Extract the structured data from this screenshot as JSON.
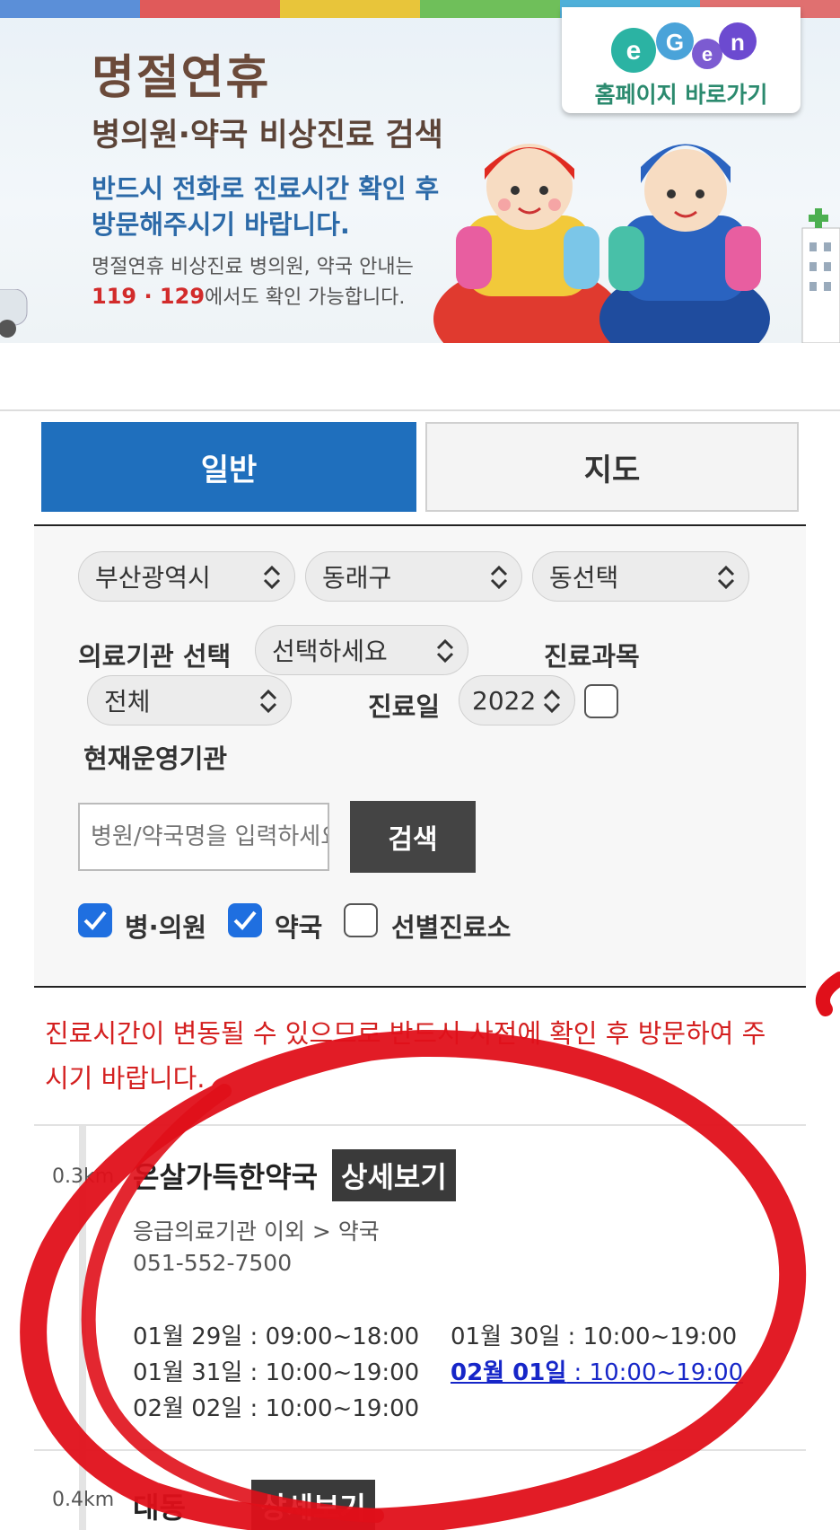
{
  "banner": {
    "title": "명절연휴",
    "subtitle": "병의원·약국 비상진료 검색",
    "blue_line1": "반드시 전화로 진료시간 확인 후",
    "blue_line2": "방문해주시기 바랍니다.",
    "small_line1": "명절연휴 비상진료 병의원, 약국 안내는",
    "small_red": "119 · 129",
    "small_line2_rest": "에서도 확인 가능합니다.",
    "homepage_label": "홈페이지 바로가기",
    "logo_text": "e-gen",
    "stripe_colors": [
      "#5b8fd8",
      "#e05a5a",
      "#e8c53a",
      "#6fbf5a",
      "#4fb0d9",
      "#e07070"
    ]
  },
  "tabs": [
    {
      "label": "일반",
      "active": true
    },
    {
      "label": "지도",
      "active": false
    }
  ],
  "filters": {
    "city": "부산광역시",
    "district": "동래구",
    "dong": "동선택",
    "institution_label": "의료기관 선택",
    "institution_value": "선택하세요",
    "department_label": "진료과목",
    "department_value": "전체",
    "date_label": "진료일",
    "date_value": "2022",
    "operating_label": "현재운영기관",
    "operating_checked": false,
    "search_placeholder": "병원/약국명을 입력하세요",
    "search_button": "검색",
    "checkboxes": [
      {
        "label": "병·의원",
        "checked": true
      },
      {
        "label": "약국",
        "checked": true
      },
      {
        "label": "선별진료소",
        "checked": false
      }
    ]
  },
  "notice": "진료시간이 변동될 수 있으므로 반드시 사전에 확인 후 방문하여 주시기 바랍니다.",
  "results": [
    {
      "distance": "0.3km",
      "name": "온살가득한약국",
      "detail_button": "상세보기",
      "category": "응급의료기관 이외 > 약국",
      "phone": "051-552-7500",
      "hours": [
        {
          "date": "01월 29일",
          "time": " : 09:00~18:00",
          "highlight": false
        },
        {
          "date": "01월 30일",
          "time": " : 10:00~19:00",
          "highlight": false
        },
        {
          "date": "01월 31일",
          "time": " : 10:00~19:00",
          "highlight": false
        },
        {
          "date": "02월 01일",
          "time": " : 10:00~19:00",
          "highlight": true
        },
        {
          "date": "02월 02일",
          "time": " : 10:00~19:00",
          "highlight": false
        }
      ]
    },
    {
      "distance": "0.4km",
      "name": "대동",
      "detail_button": "상세보기"
    }
  ],
  "colors": {
    "primary_blue": "#1f6fbd",
    "notice_red": "#d42020",
    "highlight_link": "#1626c8",
    "marker_red": "#e0101a"
  }
}
